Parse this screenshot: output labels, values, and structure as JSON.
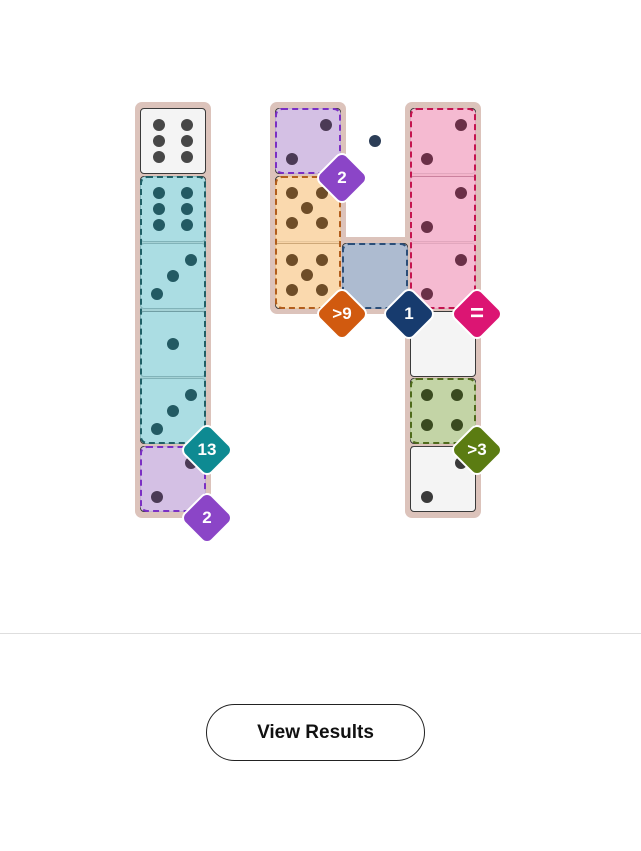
{
  "board": {
    "palette": {
      "board_bg": "#dcc3bb",
      "cell_bg": "#f4f4f4",
      "pip_default": "#474747",
      "teal": "#0e8a92",
      "purple": "#8b45c7",
      "orange": "#d15a0f",
      "navy": "#173b6e",
      "pink": "#dc1573",
      "green": "#5b7c12"
    },
    "constraints": [
      {
        "id": "col1-sum",
        "text": "13",
        "color": "#0e8a92",
        "icon": "diamond-badge"
      },
      {
        "id": "col1-bottom-sum",
        "text": "2",
        "color": "#8b45c7",
        "icon": "diamond-badge"
      },
      {
        "id": "col2-top-sum",
        "text": "2",
        "color": "#8b45c7",
        "icon": "diamond-badge"
      },
      {
        "id": "col2-greater",
        "text": ">9",
        "color": "#d15a0f",
        "icon": "diamond-badge"
      },
      {
        "id": "middle-sum",
        "text": "1",
        "color": "#173b6e",
        "icon": "diamond-badge"
      },
      {
        "id": "col3-equal",
        "text": "=",
        "color": "#dc1573",
        "icon": "diamond-badge"
      },
      {
        "id": "col3-greater",
        "text": ">3",
        "color": "#5b7c12",
        "icon": "diamond-badge"
      }
    ],
    "dice_values": {
      "col1": [
        6,
        6,
        3,
        1,
        3,
        2
      ],
      "col2": [
        2,
        5,
        5
      ],
      "middle": [
        1
      ],
      "col3": [
        2,
        2,
        2,
        0,
        4,
        2
      ]
    }
  },
  "footer": {
    "view_results_label": "View Results"
  }
}
